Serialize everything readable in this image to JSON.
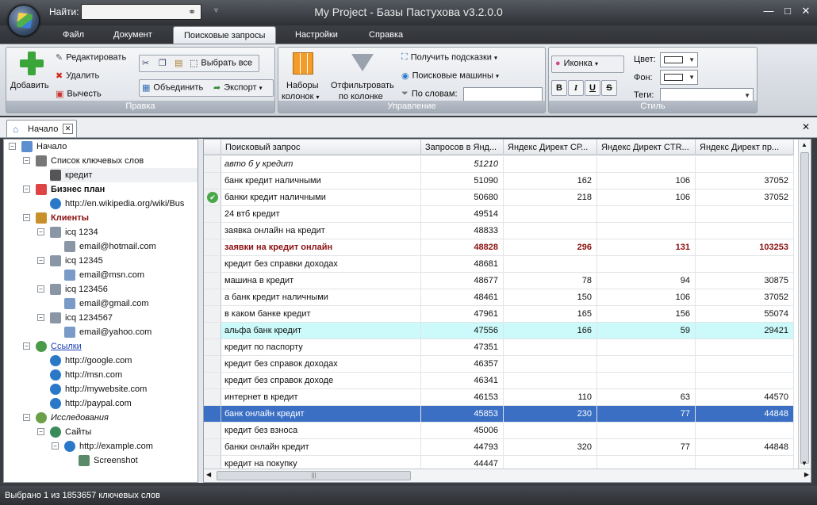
{
  "titlebar": {
    "find_label": "Найти:",
    "find_value": "",
    "title": "My Project - Базы Пастухова v3.2.0.0",
    "minimize": "—",
    "maximize": "□",
    "close": "✕"
  },
  "menu": {
    "tabs": [
      "Файл",
      "Документ",
      "Поисковые запросы",
      "Настройки",
      "Справка"
    ],
    "active": "Поисковые запросы"
  },
  "ribbon": {
    "pravka": {
      "caption": "Правка",
      "add": "Добавить",
      "edit": "Редактировать",
      "delete": "Удалить",
      "cut": "Вычесть",
      "select_all": "Выбрать все",
      "merge": "Объединить",
      "export": "Экспорт"
    },
    "upravlenie": {
      "caption": "Управление",
      "column_sets": "Наборы\nколонок",
      "column_sets_l1": "Наборы",
      "column_sets_l2": "колонок",
      "filter_l1": "Отфильтровать",
      "filter_l2": "по колонке",
      "hints": "Получить подсказки",
      "engines": "Поисковые машины",
      "by_words": "По словам:",
      "by_words_value": ""
    },
    "stil": {
      "caption": "Стиль",
      "icon": "Иконка",
      "color": "Цвет:",
      "bg": "Фон:",
      "tags": "Теги:",
      "bold": "B",
      "italic": "I",
      "underline": "U",
      "strike": "S"
    }
  },
  "doctab": {
    "label": "Начало"
  },
  "tree": [
    {
      "label": "Начало",
      "depth": 0,
      "style": "normal",
      "icon": "home-icon"
    },
    {
      "label": "Список ключевых слов",
      "depth": 1,
      "style": "normal",
      "icon": "list-icon"
    },
    {
      "label": "кредит",
      "depth": 2,
      "style": "normal",
      "icon": "keyword-icon"
    },
    {
      "label": "Бизнес план",
      "depth": 1,
      "style": "bold",
      "icon": "chart-icon"
    },
    {
      "label": "http://en.wikipedia.org/wiki/Bus",
      "depth": 2,
      "style": "normal",
      "icon": "globe-icon"
    },
    {
      "label": "Клиенты",
      "depth": 1,
      "style": "bold-red",
      "icon": "people-icon"
    },
    {
      "label": "icq 1234",
      "depth": 2,
      "style": "normal",
      "icon": "document-icon"
    },
    {
      "label": "email@hotmail.com",
      "depth": 3,
      "style": "normal",
      "icon": "document-icon"
    },
    {
      "label": "icq 12345",
      "depth": 2,
      "style": "normal",
      "icon": "document-icon"
    },
    {
      "label": "email@msn.com",
      "depth": 3,
      "style": "normal",
      "icon": "mail-icon"
    },
    {
      "label": "icq 123456",
      "depth": 2,
      "style": "normal",
      "icon": "document-icon"
    },
    {
      "label": "email@gmail.com",
      "depth": 3,
      "style": "normal",
      "icon": "mail-icon"
    },
    {
      "label": "icq 1234567",
      "depth": 2,
      "style": "normal",
      "icon": "document-icon"
    },
    {
      "label": "email@yahoo.com",
      "depth": 3,
      "style": "normal",
      "icon": "mail-icon"
    },
    {
      "label": "Ссылки",
      "depth": 1,
      "style": "link",
      "icon": "links-icon"
    },
    {
      "label": "http://google.com",
      "depth": 2,
      "style": "normal",
      "icon": "globe-icon"
    },
    {
      "label": "http://msn.com",
      "depth": 2,
      "style": "normal",
      "icon": "globe-icon"
    },
    {
      "label": "http://mywebsite.com",
      "depth": 2,
      "style": "normal",
      "icon": "globe-icon"
    },
    {
      "label": "http://paypal.com",
      "depth": 2,
      "style": "normal",
      "icon": "globe-icon"
    },
    {
      "label": "Исследования",
      "depth": 1,
      "style": "italic",
      "icon": "research-icon"
    },
    {
      "label": "Сайты",
      "depth": 2,
      "style": "normal",
      "icon": "sites-icon"
    },
    {
      "label": "http://example.com",
      "depth": 3,
      "style": "normal",
      "icon": "globe-icon"
    },
    {
      "label": "Screenshot",
      "depth": 4,
      "style": "normal",
      "icon": "image-icon"
    }
  ],
  "grid": {
    "columns": [
      "Поисковый запрос",
      "Запросов в Янд...",
      "Яндекс Директ СР...",
      "Яндекс Директ CTR...",
      "Яндекс Директ пр..."
    ],
    "rows": [
      {
        "q": "авто б у кредит",
        "v": [
          "51210",
          "",
          "",
          ""
        ],
        "style": "italic"
      },
      {
        "q": "банк кредит наличными",
        "v": [
          "51090",
          "162",
          "106",
          "37052"
        ],
        "style": "normal"
      },
      {
        "q": "банки кредит наличными",
        "v": [
          "50680",
          "218",
          "106",
          "37052"
        ],
        "style": "normal",
        "check": true
      },
      {
        "q": "24 втб кредит",
        "v": [
          "49514",
          "",
          "",
          ""
        ],
        "style": "normal"
      },
      {
        "q": "заявка онлайн на кредит",
        "v": [
          "48833",
          "",
          "",
          ""
        ],
        "style": "normal"
      },
      {
        "q": "заявки на кредит онлайн",
        "v": [
          "48828",
          "296",
          "131",
          "103253"
        ],
        "style": "bold-red"
      },
      {
        "q": "кредит без справки доходах",
        "v": [
          "48681",
          "",
          "",
          ""
        ],
        "style": "normal"
      },
      {
        "q": "машина в кредит",
        "v": [
          "48677",
          "78",
          "94",
          "30875"
        ],
        "style": "normal"
      },
      {
        "q": "а банк кредит наличными",
        "v": [
          "48461",
          "150",
          "106",
          "37052"
        ],
        "style": "normal"
      },
      {
        "q": "в каком банке кредит",
        "v": [
          "47961",
          "165",
          "156",
          "55074"
        ],
        "style": "normal"
      },
      {
        "q": "альфа банк кредит",
        "v": [
          "47556",
          "166",
          "59",
          "29421"
        ],
        "style": "cyan"
      },
      {
        "q": "кредит по паспорту",
        "v": [
          "47351",
          "",
          "",
          ""
        ],
        "style": "normal"
      },
      {
        "q": "кредит без справок доходах",
        "v": [
          "46357",
          "",
          "",
          ""
        ],
        "style": "normal"
      },
      {
        "q": "кредит без справок доходе",
        "v": [
          "46341",
          "",
          "",
          ""
        ],
        "style": "normal"
      },
      {
        "q": "интернет в кредит",
        "v": [
          "46153",
          "110",
          "63",
          "44570"
        ],
        "style": "normal"
      },
      {
        "q": "банк онлайн кредит",
        "v": [
          "45853",
          "230",
          "77",
          "44848"
        ],
        "style": "selected"
      },
      {
        "q": "кредит без взноса",
        "v": [
          "45006",
          "",
          "",
          ""
        ],
        "style": "normal"
      },
      {
        "q": "банки онлайн кредит",
        "v": [
          "44793",
          "320",
          "77",
          "44848"
        ],
        "style": "normal"
      },
      {
        "q": "кредит на покупку",
        "v": [
          "44447",
          "",
          "",
          ""
        ],
        "style": "normal"
      }
    ]
  },
  "status": {
    "text": "Выбрано 1 из 1853657 ключевых слов"
  },
  "colors": {
    "selected": "#3a6fc4",
    "cyan": "#ccfafa",
    "red": "#8b1010",
    "link": "#1a3fb5"
  }
}
